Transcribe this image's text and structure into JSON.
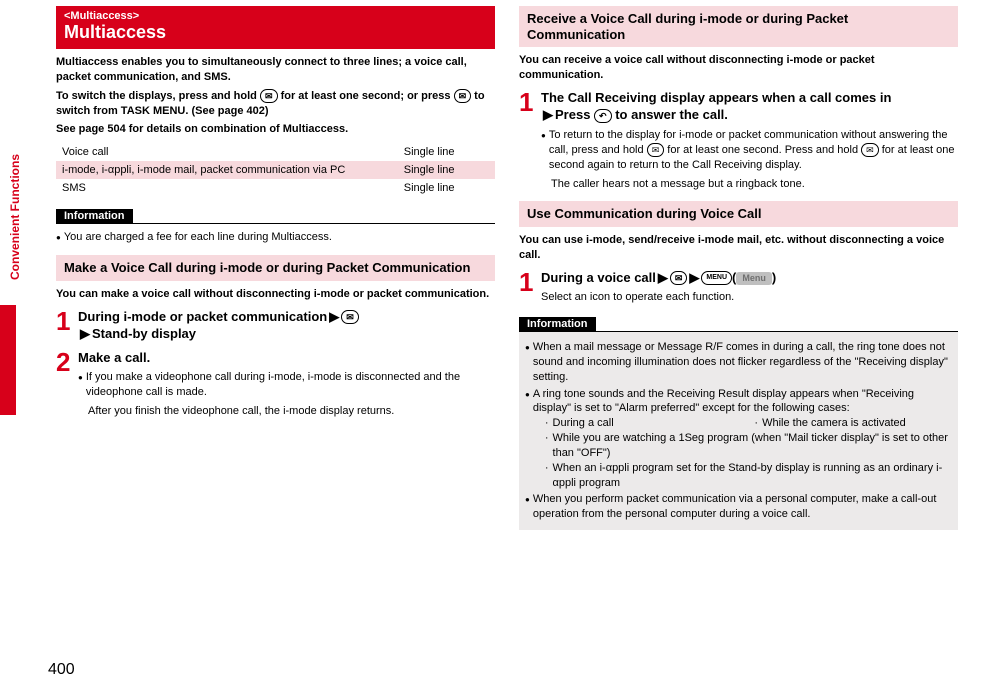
{
  "side_tab": "Convenient Functions",
  "page_number": "400",
  "left": {
    "header_tag": "<Multiaccess>",
    "header_title": "Multiaccess",
    "intro_l1": "Multiaccess enables you to simultaneously connect to three lines; a voice call, packet communication, and SMS.",
    "intro_l2a": "To switch the displays, press and hold ",
    "intro_l2b": " for at least one second; or press ",
    "intro_l2c": " to switch from TASK MENU. (See page 402)",
    "intro_l3": "See page 504 for details on combination of Multiaccess.",
    "key_multi": "✉",
    "table": {
      "r1c1": "Voice call",
      "r1c2": "Single line",
      "r2c1": "i-mode, i-αppli, i-mode mail, packet communication via PC",
      "r2c2": "Single line",
      "r3c1": "SMS",
      "r3c2": "Single line"
    },
    "info_label": "Information",
    "info1": "You are charged a fee for each line during Multiaccess.",
    "sec1_title": "Make a Voice Call during i-mode or during Packet Communication",
    "sec1_intro": "You can make a voice call without disconnecting i-mode or packet communication.",
    "s1_num": "1",
    "s1_t1": "During i-mode or packet communication",
    "s1_t2": "Stand-by display",
    "s2_num": "2",
    "s2_title": "Make a call.",
    "s2_b1": "If you make a videophone call during i-mode, i-mode is disconnected and the videophone call is made.",
    "s2_b2": "After you finish the videophone call, the i-mode display returns."
  },
  "right": {
    "sec2_title": "Receive a Voice Call during i-mode or during Packet Communication",
    "sec2_intro": "You can receive a voice call without disconnecting i-mode or packet communication.",
    "r1_num": "1",
    "r1_t1": "The Call Receiving display appears when a call comes in",
    "r1_t2a": "Press ",
    "r1_t2b": " to answer the call.",
    "key_call": "↶",
    "r1_b1a": "To return to the display for i-mode or packet communication without answering the call, press and hold ",
    "r1_b1b": " for at least one second. Press and hold ",
    "r1_b1c": " for at least one second again to return to the Call Receiving display.",
    "r1_b2": "The caller hears not a message but a ringback tone.",
    "sec3_title": "Use Communication during Voice Call",
    "sec3_intro": "You can use i-mode, send/receive i-mode mail, etc. without disconnecting a voice call.",
    "r2_num": "1",
    "r2_t1": "During a voice call",
    "key_menu": "MENU",
    "menu_pill": "Menu",
    "r2_sub": "Select an icon to operate each function.",
    "info_label": "Information",
    "ib1": "When a mail message or Message R/F comes in during a call, the ring tone does not sound and incoming illumination does not flicker regardless of the \"Receiving display\" setting.",
    "ib2": "A ring tone sounds and the Receiving Result display appears when \"Receiving display\" is set to \"Alarm preferred\" except for the following cases:",
    "ib2s1a": "During a call",
    "ib2s1b": "While the camera is activated",
    "ib2s2": "While you are watching a 1Seg program (when \"Mail ticker display\" is set to other than \"OFF\")",
    "ib2s3": "When an i-αppli program set for the Stand-by display is running as an ordinary i-αppli program",
    "ib3": "When you perform packet communication via a personal computer, make a call-out operation from the personal computer during a voice call."
  }
}
